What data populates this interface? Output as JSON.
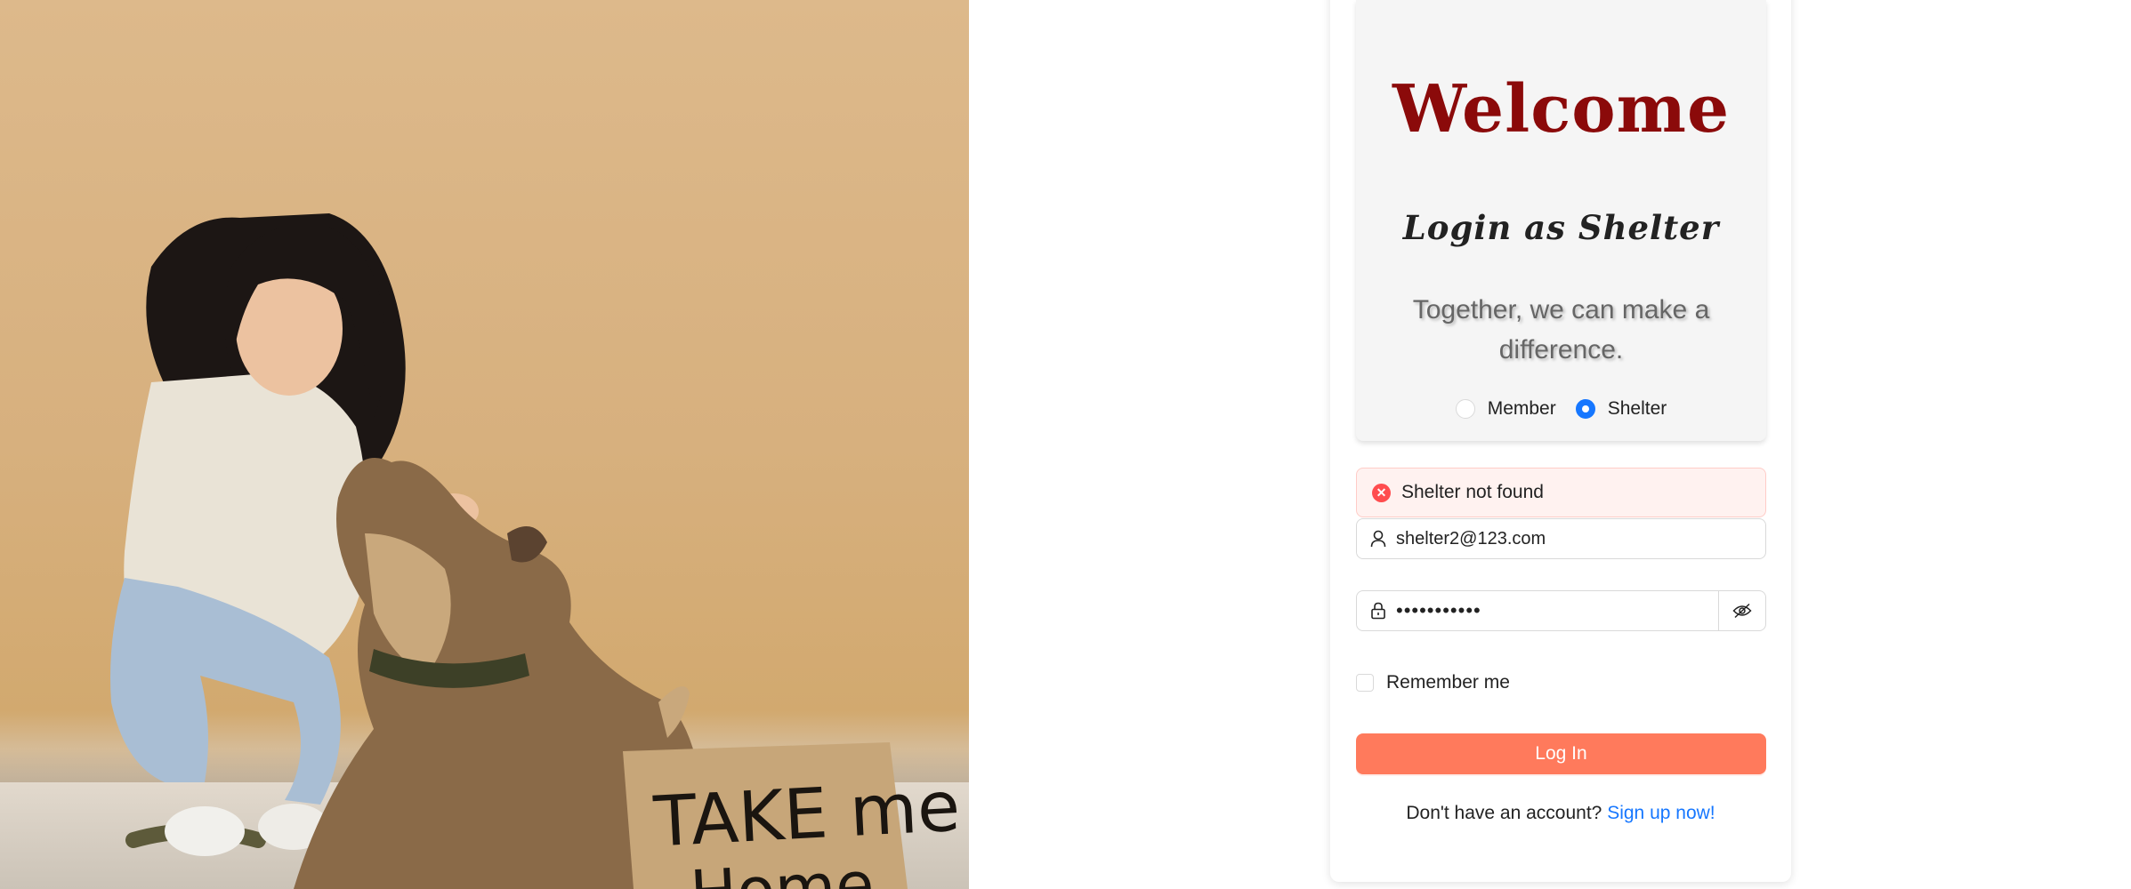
{
  "photo": {
    "alt": "Woman petting a dog next to a cardboard sign",
    "sign_text_line1": "TAKE me",
    "sign_text_line2": "Home"
  },
  "header": {
    "title": "Welcome",
    "subtitle": "Login as Shelter",
    "tagline": "Together, we can make a difference."
  },
  "role": {
    "options": [
      {
        "label": "Member",
        "checked": false
      },
      {
        "label": "Shelter",
        "checked": true
      }
    ]
  },
  "alert": {
    "type": "error",
    "message": "Shelter not found",
    "icon": "close-circle-icon"
  },
  "form": {
    "email": {
      "value": "shelter2@123.com",
      "icon": "user-icon"
    },
    "password": {
      "value": "•••••••••••",
      "icon": "lock-icon",
      "toggle_icon": "eye-invisible-icon"
    },
    "remember_label": "Remember me",
    "remember_checked": false,
    "submit_label": "Log In"
  },
  "footer": {
    "prompt": "Don't have an account?",
    "link_label": "Sign up now!"
  },
  "colors": {
    "title": "#8b0a0a",
    "primary_button": "#ff7a5c",
    "link": "#1677ff",
    "radio_checked": "#1677ff",
    "error": "#ff4d4f"
  }
}
